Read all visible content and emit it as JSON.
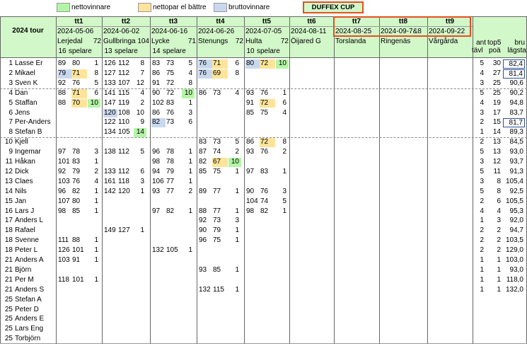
{
  "legend": [
    {
      "label": "nettovinnare",
      "color": "#b3f5a6"
    },
    {
      "label": "nettopar el bättre",
      "color": "#fde49a"
    },
    {
      "label": "bruttovinnare",
      "color": "#c8d8ee"
    }
  ],
  "cup_label": "DUFFEX CUP",
  "colors": {
    "green": "#b3f5a6",
    "yellow": "#fde49a",
    "blue": "#c8d8ee",
    "header_bg": "#d2f7c9",
    "accent_border": "#e45020"
  },
  "tour_label": "2024 tour",
  "totals_headers": {
    "ant_top": "ant",
    "ant_bottom": "tävl",
    "top5_top": "top5",
    "top5_bottom": "poä",
    "bru_top": "bru",
    "bru_bottom": "lägsta"
  },
  "tournaments": [
    {
      "title": "tt1",
      "date": "2024-05-06",
      "course": "Lerjedal",
      "par": "72",
      "players": "16",
      "players_label": "spelare"
    },
    {
      "title": "tt2",
      "date": "2024-06-02",
      "course": "Gullbringa",
      "par": "104",
      "players": "13",
      "players_label": "spelare"
    },
    {
      "title": "tt3",
      "date": "2024-06-16",
      "course": "Lycke",
      "par": "71",
      "players": "14",
      "players_label": "spelare"
    },
    {
      "title": "tt4",
      "date": "2024-06-26",
      "course": "Stenungs",
      "par": "72",
      "players": "",
      "players_label": ""
    },
    {
      "title": "tt5",
      "date": "2024-07-05",
      "course": "Hulta",
      "par": "72",
      "players": "10",
      "players_label": "spelare"
    },
    {
      "title": "tt6",
      "date": "2024-08-11",
      "course": "Öijared G",
      "par": "",
      "players": "",
      "players_label": ""
    },
    {
      "title": "tt7",
      "date": "2024-08-25",
      "course": "Torslanda",
      "par": "",
      "players": "",
      "players_label": ""
    },
    {
      "title": "tt8",
      "date": "2024-09-7&8",
      "course": "Ringenäs",
      "par": "",
      "players": "",
      "players_label": ""
    },
    {
      "title": "tt9",
      "date": "2024-09-22",
      "course": "Vårgårda",
      "par": "",
      "players": "",
      "players_label": ""
    }
  ],
  "rows": [
    {
      "rank": "1",
      "name": "Lasse Er",
      "scores": [
        [
          "89",
          "80",
          "1"
        ],
        [
          "126",
          "112",
          "8"
        ],
        [
          "83",
          "73",
          "5"
        ],
        [
          "76",
          "71",
          "6"
        ],
        [
          "80",
          "72",
          "10"
        ]
      ],
      "hl": [
        [
          "",
          "",
          ""
        ],
        [
          "",
          "",
          ""
        ],
        [
          "",
          "",
          ""
        ],
        [
          "blue",
          "yellow",
          ""
        ],
        [
          "blue",
          "yellow",
          "green"
        ]
      ],
      "ant": "5",
      "top5": "30",
      "bru": "82,4",
      "boxed": true
    },
    {
      "rank": "2",
      "name": "Mikael",
      "scores": [
        [
          "79",
          "71",
          "8"
        ],
        [
          "127",
          "112",
          "7"
        ],
        [
          "86",
          "75",
          "4"
        ],
        [
          "76",
          "69",
          "8"
        ],
        [
          "",
          "",
          ""
        ]
      ],
      "hl": [
        [
          "blue",
          "yellow",
          ""
        ],
        [
          "",
          "",
          ""
        ],
        [
          "",
          "",
          ""
        ],
        [
          "blue",
          "yellow",
          ""
        ],
        [
          "",
          "",
          ""
        ]
      ],
      "ant": "4",
      "top5": "27",
      "bru": "81,4",
      "boxed": true
    },
    {
      "rank": "3",
      "name": "Sven K",
      "scores": [
        [
          "92",
          "76",
          "5"
        ],
        [
          "133",
          "107",
          "12"
        ],
        [
          "91",
          "72",
          "8"
        ],
        [
          "",
          "",
          ""
        ],
        [
          "",
          "",
          ""
        ]
      ],
      "hl": [],
      "ant": "3",
      "top5": "25",
      "bru": "90,6",
      "boxed": false
    },
    {
      "rank": "4",
      "name": "Dan",
      "scores": [
        [
          "88",
          "71",
          "6"
        ],
        [
          "141",
          "115",
          "4"
        ],
        [
          "90",
          "72",
          "10"
        ],
        [
          "86",
          "73",
          "4"
        ],
        [
          "93",
          "76",
          "1"
        ]
      ],
      "hl": [
        [
          "",
          "yellow",
          ""
        ],
        [
          "",
          "",
          ""
        ],
        [
          "",
          "",
          "green"
        ],
        [
          "",
          "",
          ""
        ],
        [
          "",
          "",
          ""
        ]
      ],
      "ant": "5",
      "top5": "25",
      "bru": "90,2",
      "boxed": false
    },
    {
      "rank": "5",
      "name": "Staffan",
      "scores": [
        [
          "88",
          "70",
          "10"
        ],
        [
          "147",
          "119",
          "2"
        ],
        [
          "102",
          "83",
          "1"
        ],
        [
          "",
          "",
          ""
        ],
        [
          "91",
          "72",
          "6"
        ]
      ],
      "hl": [
        [
          "",
          "yellow",
          "green"
        ],
        [
          "",
          "",
          ""
        ],
        [
          "",
          "",
          ""
        ],
        [
          "",
          "",
          ""
        ],
        [
          "",
          "yellow",
          ""
        ]
      ],
      "ant": "4",
      "top5": "19",
      "bru": "94,8",
      "boxed": false
    },
    {
      "rank": "6",
      "name": "Jens",
      "scores": [
        [
          "",
          "",
          ""
        ],
        [
          "120",
          "108",
          "10"
        ],
        [
          "86",
          "76",
          "3"
        ],
        [
          "",
          "",
          ""
        ],
        [
          "85",
          "75",
          "4"
        ]
      ],
      "hl": [
        [
          "",
          "",
          ""
        ],
        [
          "blue",
          "",
          ""
        ]
      ],
      "ant": "3",
      "top5": "17",
      "bru": "83,7",
      "boxed": false
    },
    {
      "rank": "7",
      "name": "Per-Anders",
      "scores": [
        [
          "",
          "",
          ""
        ],
        [
          "122",
          "110",
          "9"
        ],
        [
          "82",
          "73",
          "6"
        ],
        [
          "",
          "",
          ""
        ],
        [
          "",
          "",
          ""
        ]
      ],
      "hl": [
        [
          "",
          "",
          ""
        ],
        [
          "",
          "",
          ""
        ],
        [
          "blue",
          "",
          ""
        ]
      ],
      "ant": "2",
      "top5": "15",
      "bru": "81,7",
      "boxed": true
    },
    {
      "rank": "8",
      "name": "Stefan B",
      "scores": [
        [
          "",
          "",
          ""
        ],
        [
          "134",
          "105",
          "14"
        ],
        [
          "",
          "",
          ""
        ],
        [
          "",
          "",
          ""
        ],
        [
          "",
          "",
          ""
        ]
      ],
      "hl": [
        [
          "",
          "",
          ""
        ],
        [
          "",
          "",
          "green"
        ]
      ],
      "ant": "1",
      "top5": "14",
      "bru": "89,3",
      "boxed": false
    },
    {
      "rank": "10",
      "name": "Kjell",
      "scores": [
        [
          "",
          "",
          ""
        ],
        [
          "",
          "",
          ""
        ],
        [
          "",
          "",
          ""
        ],
        [
          "83",
          "73",
          "5"
        ],
        [
          "86",
          "72",
          "8"
        ]
      ],
      "hl": [
        [
          "",
          "",
          ""
        ],
        [
          "",
          "",
          ""
        ],
        [
          "",
          "",
          ""
        ],
        [
          "",
          "",
          ""
        ],
        [
          "",
          "yellow",
          ""
        ]
      ],
      "ant": "2",
      "top5": "13",
      "bru": "84,5",
      "boxed": false
    },
    {
      "rank": "9",
      "name": "Ingemar",
      "scores": [
        [
          "97",
          "78",
          "3"
        ],
        [
          "138",
          "112",
          "5"
        ],
        [
          "96",
          "78",
          "1"
        ],
        [
          "87",
          "74",
          "2"
        ],
        [
          "93",
          "76",
          "2"
        ]
      ],
      "hl": [],
      "ant": "5",
      "top5": "13",
      "bru": "93,0",
      "boxed": false
    },
    {
      "rank": "11",
      "name": "Håkan",
      "scores": [
        [
          "101",
          "83",
          "1"
        ],
        [
          "",
          "",
          ""
        ],
        [
          "98",
          "78",
          "1"
        ],
        [
          "82",
          "67",
          "10"
        ],
        [
          "",
          "",
          ""
        ]
      ],
      "hl": [
        [
          "",
          "",
          ""
        ],
        [
          "",
          "",
          ""
        ],
        [
          "",
          "",
          ""
        ],
        [
          "",
          "yellow",
          "green"
        ]
      ],
      "ant": "3",
      "top5": "12",
      "bru": "93,7",
      "boxed": false
    },
    {
      "rank": "12",
      "name": "Dick",
      "scores": [
        [
          "92",
          "79",
          "2"
        ],
        [
          "133",
          "112",
          "6"
        ],
        [
          "94",
          "79",
          "1"
        ],
        [
          "85",
          "75",
          "1"
        ],
        [
          "97",
          "83",
          "1"
        ]
      ],
      "hl": [],
      "ant": "5",
      "top5": "11",
      "bru": "91,3",
      "boxed": false
    },
    {
      "rank": "13",
      "name": "Claes",
      "scores": [
        [
          "103",
          "76",
          "4"
        ],
        [
          "161",
          "118",
          "3"
        ],
        [
          "106",
          "77",
          "1"
        ],
        [
          "",
          "",
          ""
        ],
        [
          "",
          "",
          ""
        ]
      ],
      "hl": [],
      "ant": "3",
      "top5": "8",
      "bru": "105,4",
      "boxed": false
    },
    {
      "rank": "14",
      "name": "Nils",
      "scores": [
        [
          "96",
          "82",
          "1"
        ],
        [
          "142",
          "120",
          "1"
        ],
        [
          "93",
          "77",
          "2"
        ],
        [
          "89",
          "77",
          "1"
        ],
        [
          "90",
          "76",
          "3"
        ]
      ],
      "hl": [],
      "ant": "5",
      "top5": "8",
      "bru": "92,5",
      "boxed": false
    },
    {
      "rank": "15",
      "name": "Jan",
      "scores": [
        [
          "107",
          "80",
          "1"
        ],
        [
          "",
          "",
          ""
        ],
        [
          "",
          "",
          ""
        ],
        [
          "",
          "",
          ""
        ],
        [
          "104",
          "74",
          "5"
        ]
      ],
      "hl": [],
      "ant": "2",
      "top5": "6",
      "bru": "105,5",
      "boxed": false
    },
    {
      "rank": "16",
      "name": "Lars J",
      "scores": [
        [
          "98",
          "85",
          "1"
        ],
        [
          "",
          "",
          ""
        ],
        [
          "97",
          "82",
          "1"
        ],
        [
          "88",
          "77",
          "1"
        ],
        [
          "98",
          "82",
          "1"
        ]
      ],
      "hl": [],
      "ant": "4",
      "top5": "4",
      "bru": "95,3",
      "boxed": false
    },
    {
      "rank": "17",
      "name": "Anders L",
      "scores": [
        [
          "",
          "",
          ""
        ],
        [
          "",
          "",
          ""
        ],
        [
          "",
          "",
          ""
        ],
        [
          "92",
          "73",
          "3"
        ],
        [
          "",
          "",
          ""
        ]
      ],
      "hl": [],
      "ant": "1",
      "top5": "3",
      "bru": "92,0",
      "boxed": false
    },
    {
      "rank": "18",
      "name": "Rafael",
      "scores": [
        [
          "",
          "",
          ""
        ],
        [
          "149",
          "127",
          "1"
        ],
        [
          "",
          "",
          ""
        ],
        [
          "90",
          "79",
          "1"
        ],
        [
          "",
          "",
          ""
        ]
      ],
      "hl": [],
      "ant": "2",
      "top5": "2",
      "bru": "94,7",
      "boxed": false
    },
    {
      "rank": "18",
      "name": "Svenne",
      "scores": [
        [
          "111",
          "88",
          "1"
        ],
        [
          "",
          "",
          ""
        ],
        [
          "",
          "",
          ""
        ],
        [
          "96",
          "75",
          "1"
        ],
        [
          "",
          "",
          ""
        ]
      ],
      "hl": [],
      "ant": "2",
      "top5": "2",
      "bru": "103,5",
      "boxed": false
    },
    {
      "rank": "18",
      "name": "Peter L",
      "scores": [
        [
          "126",
          "101",
          "1"
        ],
        [
          "",
          "",
          ""
        ],
        [
          "132",
          "105",
          "1"
        ],
        [
          "",
          "",
          ""
        ],
        [
          "",
          "",
          ""
        ]
      ],
      "hl": [],
      "ant": "2",
      "top5": "2",
      "bru": "129,0",
      "boxed": false
    },
    {
      "rank": "21",
      "name": "Anders A",
      "scores": [
        [
          "103",
          "91",
          "1"
        ],
        [
          "",
          "",
          ""
        ],
        [
          "",
          "",
          ""
        ],
        [
          "",
          "",
          ""
        ],
        [
          "",
          "",
          ""
        ]
      ],
      "hl": [],
      "ant": "1",
      "top5": "1",
      "bru": "103,0",
      "boxed": false
    },
    {
      "rank": "21",
      "name": "Björn",
      "scores": [
        [
          "",
          "",
          ""
        ],
        [
          "",
          "",
          ""
        ],
        [
          "",
          "",
          ""
        ],
        [
          "93",
          "85",
          "1"
        ],
        [
          "",
          "",
          ""
        ]
      ],
      "hl": [],
      "ant": "1",
      "top5": "1",
      "bru": "93,0",
      "boxed": false
    },
    {
      "rank": "21",
      "name": "Per M",
      "scores": [
        [
          "118",
          "101",
          "1"
        ],
        [
          "",
          "",
          ""
        ],
        [
          "",
          "",
          ""
        ],
        [
          "",
          "",
          ""
        ],
        [
          "",
          "",
          ""
        ]
      ],
      "hl": [],
      "ant": "1",
      "top5": "1",
      "bru": "118,0",
      "boxed": false
    },
    {
      "rank": "21",
      "name": "Anders S",
      "scores": [
        [
          "",
          "",
          ""
        ],
        [
          "",
          "",
          ""
        ],
        [
          "",
          "",
          ""
        ],
        [
          "132",
          "115",
          "1"
        ],
        [
          "",
          "",
          ""
        ]
      ],
      "hl": [],
      "ant": "1",
      "top5": "1",
      "bru": "132,0",
      "boxed": false
    },
    {
      "rank": "25",
      "name": "Stefan A",
      "scores": [],
      "hl": [],
      "ant": "",
      "top5": "",
      "bru": "",
      "boxed": false
    },
    {
      "rank": "25",
      "name": "Peter D",
      "scores": [],
      "hl": [],
      "ant": "",
      "top5": "",
      "bru": "",
      "boxed": false
    },
    {
      "rank": "25",
      "name": "Anders E",
      "scores": [],
      "hl": [],
      "ant": "",
      "top5": "",
      "bru": "",
      "boxed": false
    },
    {
      "rank": "25",
      "name": "Lars Eng",
      "scores": [],
      "hl": [],
      "ant": "",
      "top5": "",
      "bru": "",
      "boxed": false
    },
    {
      "rank": "25",
      "name": "Torbjörn",
      "scores": [],
      "hl": [],
      "ant": "",
      "top5": "",
      "bru": "",
      "boxed": false
    }
  ]
}
